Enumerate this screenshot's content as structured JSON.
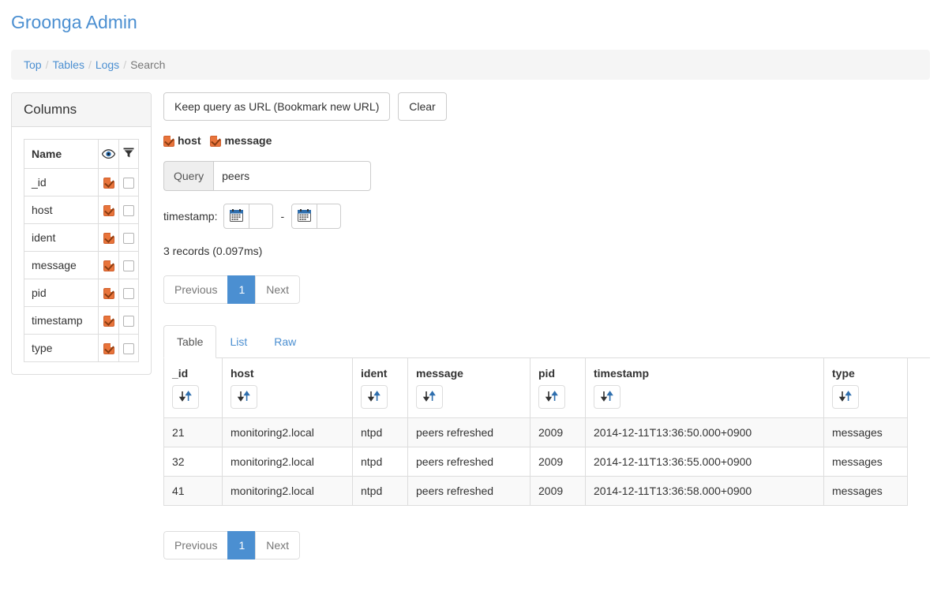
{
  "app": {
    "brand": "Groonga Admin"
  },
  "breadcrumb": {
    "items": [
      {
        "label": "Top",
        "active": false
      },
      {
        "label": "Tables",
        "active": false
      },
      {
        "label": "Logs",
        "active": false
      },
      {
        "label": "Search",
        "active": true
      }
    ],
    "separator": "/"
  },
  "columns_panel": {
    "title": "Columns",
    "headers": {
      "name": "Name",
      "visible_icon": "eye-icon",
      "filter_icon": "funnel-icon"
    },
    "rows": [
      {
        "name": "_id",
        "visible": true,
        "filter": false
      },
      {
        "name": "host",
        "visible": true,
        "filter": false
      },
      {
        "name": "ident",
        "visible": true,
        "filter": false
      },
      {
        "name": "message",
        "visible": true,
        "filter": false
      },
      {
        "name": "pid",
        "visible": true,
        "filter": false
      },
      {
        "name": "timestamp",
        "visible": true,
        "filter": false
      },
      {
        "name": "type",
        "visible": true,
        "filter": false
      }
    ]
  },
  "toolbar": {
    "keep_query_label": "Keep query as URL (Bookmark new URL)",
    "clear_label": "Clear"
  },
  "field_checks": [
    {
      "label": "host",
      "checked": true
    },
    {
      "label": "message",
      "checked": true
    }
  ],
  "query": {
    "addon_label": "Query",
    "value": "peers",
    "placeholder": ""
  },
  "timestamp_filter": {
    "label": "timestamp:",
    "separator": "-",
    "from_value": "",
    "to_value": "",
    "from_placeholder": "",
    "to_placeholder": "",
    "calendar_icon": "calendar-icon"
  },
  "records_info": "3 records (0.097ms)",
  "pagination": {
    "previous_label": "Previous",
    "next_label": "Next",
    "pages": [
      "1"
    ],
    "current_page": "1"
  },
  "tabs": [
    {
      "label": "Table",
      "active": true
    },
    {
      "label": "List",
      "active": false
    },
    {
      "label": "Raw",
      "active": false
    }
  ],
  "results": {
    "columns": [
      {
        "key": "_id",
        "label": "_id",
        "sort_icon": "sort-icon",
        "width_class": "w-id"
      },
      {
        "key": "host",
        "label": "host",
        "sort_icon": "sort-icon",
        "width_class": "w-host"
      },
      {
        "key": "ident",
        "label": "ident",
        "sort_icon": "sort-icon",
        "width_class": "w-ident"
      },
      {
        "key": "message",
        "label": "message",
        "sort_icon": "sort-icon",
        "width_class": "w-message"
      },
      {
        "key": "pid",
        "label": "pid",
        "sort_icon": "sort-icon",
        "width_class": "w-pid"
      },
      {
        "key": "timestamp",
        "label": "timestamp",
        "sort_icon": "sort-icon",
        "width_class": "w-timestamp"
      },
      {
        "key": "type",
        "label": "type",
        "sort_icon": "sort-icon",
        "width_class": "w-type"
      }
    ],
    "rows": [
      {
        "_id": "21",
        "host": "monitoring2.local",
        "ident": "ntpd",
        "message": "peers refreshed",
        "pid": "2009",
        "timestamp": "2014-12-11T13:36:50.000+0900",
        "type": "messages"
      },
      {
        "_id": "32",
        "host": "monitoring2.local",
        "ident": "ntpd",
        "message": "peers refreshed",
        "pid": "2009",
        "timestamp": "2014-12-11T13:36:55.000+0900",
        "type": "messages"
      },
      {
        "_id": "41",
        "host": "monitoring2.local",
        "ident": "ntpd",
        "message": "peers refreshed",
        "pid": "2009",
        "timestamp": "2014-12-11T13:36:58.000+0900",
        "type": "messages"
      }
    ]
  },
  "colors": {
    "link_blue": "#4b8fd1",
    "checkbox_orange": "#e8743b",
    "panel_border": "#dddddd",
    "breadcrumb_bg": "#f5f5f5",
    "row_stripe": "#f9f9f9",
    "text": "#333333"
  }
}
